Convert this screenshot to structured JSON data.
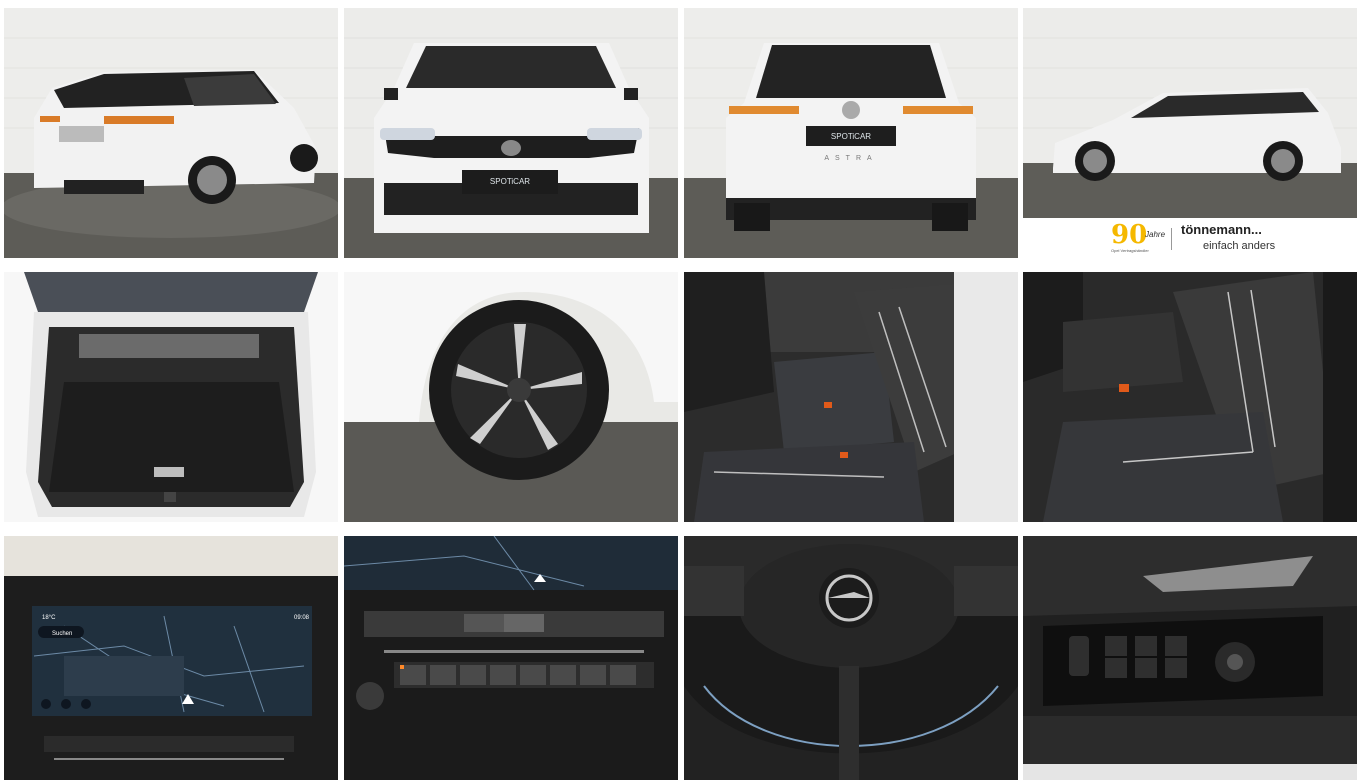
{
  "gallery": {
    "photos": [
      {
        "name": "photo-rear-three-quarter"
      },
      {
        "name": "photo-front"
      },
      {
        "name": "photo-rear"
      },
      {
        "name": "photo-side"
      },
      {
        "name": "photo-trunk"
      },
      {
        "name": "photo-wheel"
      },
      {
        "name": "photo-rear-seats"
      },
      {
        "name": "photo-front-seat"
      },
      {
        "name": "photo-infotainment"
      },
      {
        "name": "photo-climate-controls"
      },
      {
        "name": "photo-steering-wheel"
      },
      {
        "name": "photo-door-controls"
      }
    ]
  },
  "dealer": {
    "anniversary_number": "90",
    "anniversary_word": "Jahre",
    "anniversary_sub": "Opel Vertragshändler",
    "brand": "tönnemann...",
    "slogan": "einfach anders"
  },
  "plates": {
    "front_brand": "SPOTiCAR",
    "rear_brand": "SPOTiCAR",
    "rear_badge": "ASTRA"
  },
  "screen": {
    "temp": "18°C",
    "time": "09:08",
    "search_label": "Suchen"
  },
  "colors": {
    "car_white": "#f2f2f2",
    "studio_floor": "#5a5954",
    "studio_wall": "#ececea",
    "accent_amber": "#ff8a2a",
    "dealer_yellow": "#f5b800"
  }
}
